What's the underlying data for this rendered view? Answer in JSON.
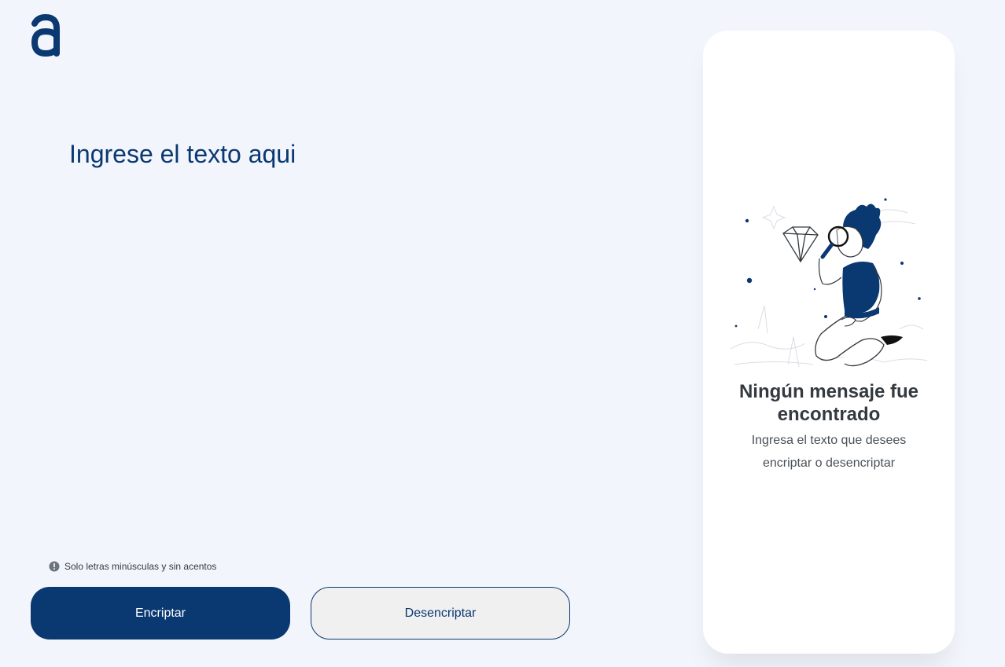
{
  "logo": {
    "icon": "alura-a-logo-icon"
  },
  "editor": {
    "placeholder": "Ingrese el texto aqui",
    "value": ""
  },
  "hint": {
    "icon": "info-circle-icon",
    "text": "Solo letras minúsculas y sin acentos"
  },
  "buttons": {
    "encrypt_label": "Encriptar",
    "decrypt_label": "Desencriptar"
  },
  "output_panel": {
    "illustration": "person-with-magnifying-glass-illustration",
    "title": "Ningún mensaje fue encontrado",
    "message": "Ingresa el texto que desees encriptar o desencriptar"
  },
  "colors": {
    "primary": "#0a3871",
    "background": "#f2f5fc",
    "panel": "#ffffff",
    "secondary_button": "#f0f0f0",
    "title_text": "#343a40",
    "body_text": "#495057"
  }
}
